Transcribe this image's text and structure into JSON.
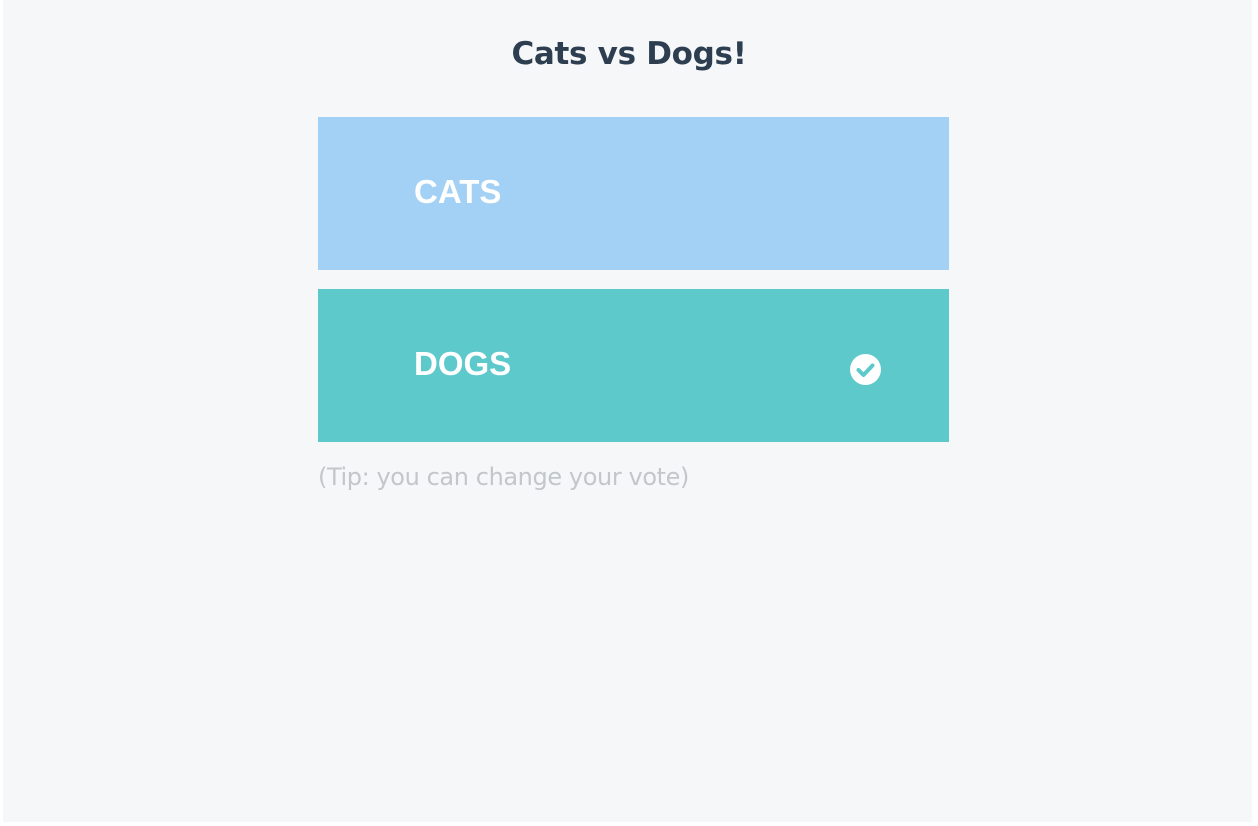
{
  "title": "Cats vs Dogs!",
  "options": [
    {
      "label": "CATS",
      "selected": false,
      "color": "#a3d0f5"
    },
    {
      "label": "DOGS",
      "selected": true,
      "color": "#5dc9cb"
    }
  ],
  "selected_icon": "check-circle-icon",
  "tip": "(Tip: you can change your vote)",
  "colors": {
    "background": "#f6f7f9",
    "title": "#2c3e50",
    "tip": "#c2c7ca"
  }
}
